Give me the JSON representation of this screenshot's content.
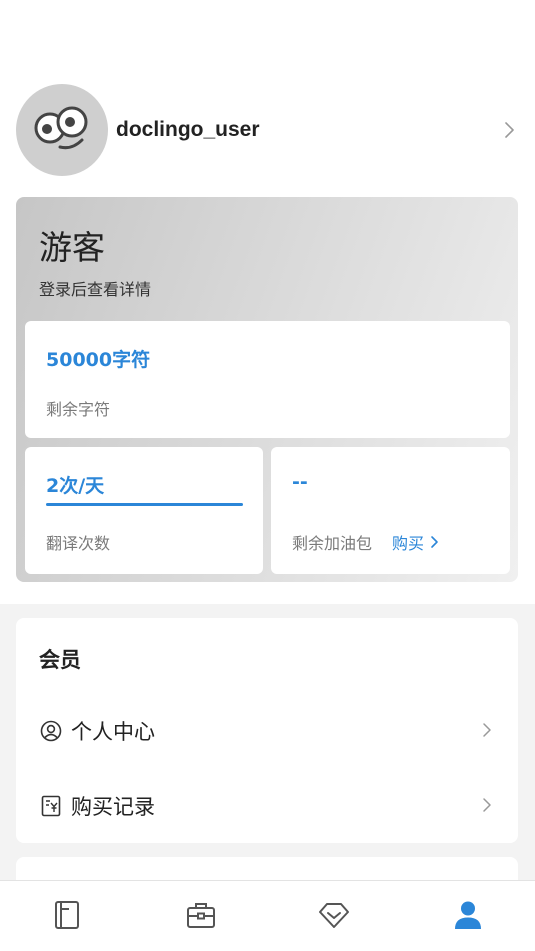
{
  "profile": {
    "username": "doclingo_user",
    "avatar_icon": "googly-eyes-avatar-icon"
  },
  "quota": {
    "title": "游客",
    "subtitle": "登录后查看详情",
    "chars_value": "50000字符",
    "chars_label": "剩余字符",
    "translations_value": "2次/天",
    "translations_label": "翻译次数",
    "pack_value": "--",
    "pack_label": "剩余加油包",
    "buy_label": "购买"
  },
  "member": {
    "section_title": "会员",
    "items": [
      {
        "label": "个人中心",
        "icon": "user-circle-icon"
      },
      {
        "label": "购买记录",
        "icon": "receipt-icon"
      }
    ]
  },
  "tabbar": {
    "tabs": [
      {
        "name": "documents",
        "icon": "document-icon",
        "active": false
      },
      {
        "name": "toolbox",
        "icon": "toolbox-icon",
        "active": false
      },
      {
        "name": "vip",
        "icon": "diamond-icon",
        "active": false
      },
      {
        "name": "profile",
        "icon": "person-icon",
        "active": true
      }
    ]
  },
  "colors": {
    "accent": "#2b86d8",
    "inactive_icon": "#555555"
  }
}
